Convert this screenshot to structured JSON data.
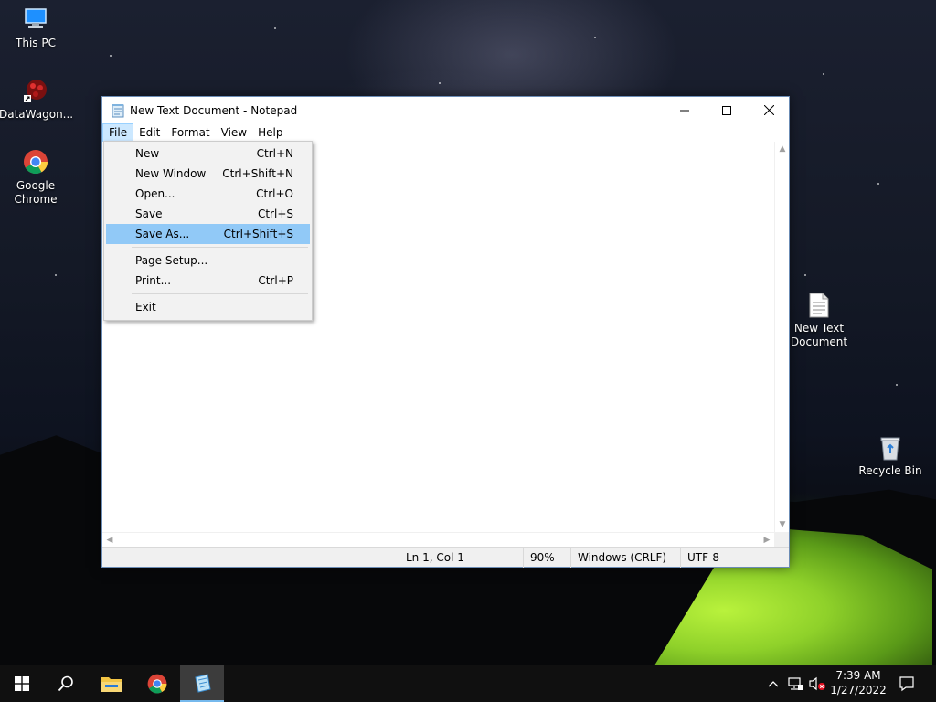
{
  "desktop": {
    "icons": [
      {
        "label": "This PC"
      },
      {
        "label": "DataWagon..."
      },
      {
        "label": "Google Chrome"
      },
      {
        "label": "New Text Document"
      },
      {
        "label": "Recycle Bin"
      }
    ]
  },
  "window": {
    "title": "New Text Document - Notepad",
    "menu": [
      "File",
      "Edit",
      "Format",
      "View",
      "Help"
    ],
    "active_menu": "File",
    "status": {
      "position": "Ln 1, Col 1",
      "zoom": "90%",
      "line_ending": "Windows (CRLF)",
      "encoding": "UTF-8"
    }
  },
  "file_menu": {
    "items": [
      {
        "label": "New",
        "shortcut": "Ctrl+N"
      },
      {
        "label": "New Window",
        "shortcut": "Ctrl+Shift+N"
      },
      {
        "label": "Open...",
        "shortcut": "Ctrl+O"
      },
      {
        "label": "Save",
        "shortcut": "Ctrl+S"
      },
      {
        "label": "Save As...",
        "shortcut": "Ctrl+Shift+S",
        "highlighted": true
      },
      {
        "label": "Page Setup...",
        "shortcut": ""
      },
      {
        "label": "Print...",
        "shortcut": "Ctrl+P"
      },
      {
        "label": "Exit",
        "shortcut": ""
      }
    ]
  },
  "taskbar": {
    "time": "7:39 AM",
    "date": "1/27/2022",
    "accent": "#76b9ed"
  }
}
